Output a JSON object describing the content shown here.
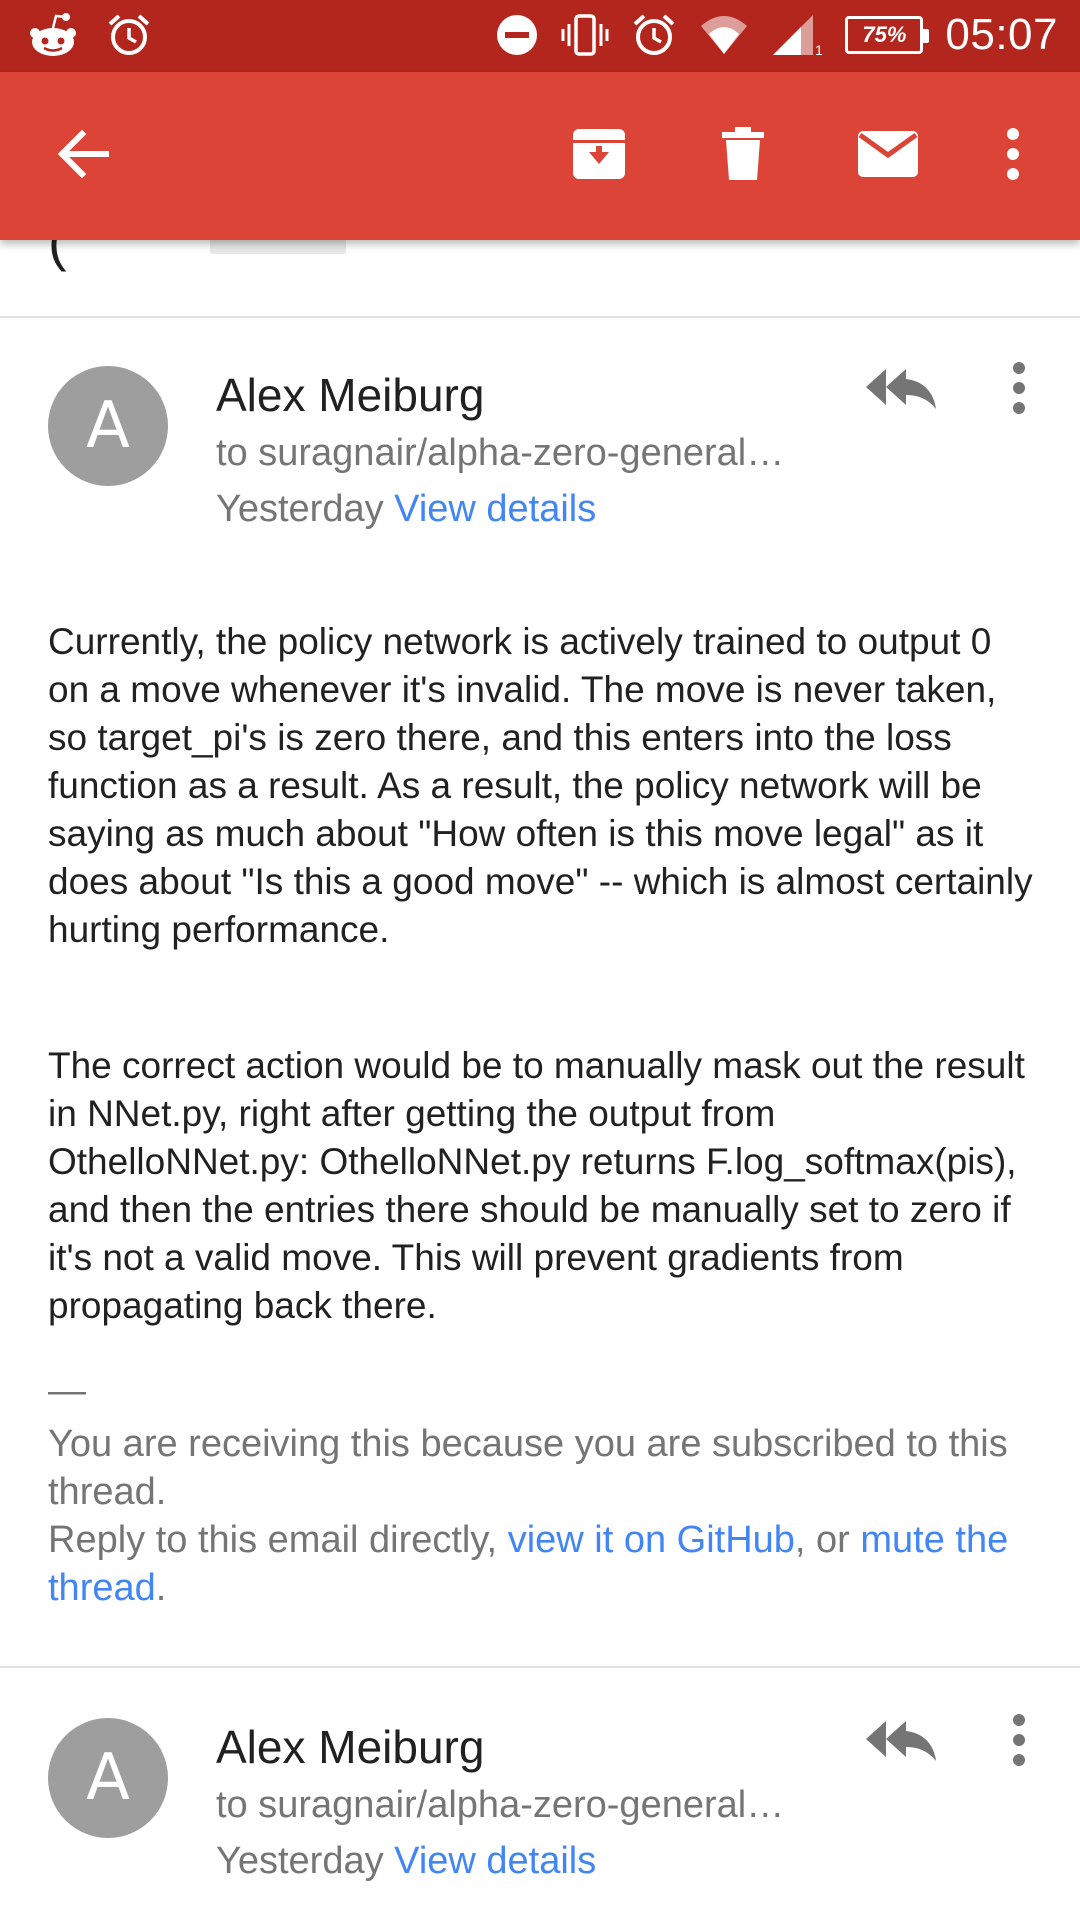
{
  "status_bar": {
    "battery_percent": "75%",
    "time": "05:07",
    "icons": [
      "reddit-icon",
      "alarm-icon",
      "do-not-disturb-icon",
      "vibrate-icon",
      "alarm-icon",
      "wifi-icon",
      "signal-icon",
      "battery-icon"
    ]
  },
  "toolbar": {
    "icons": [
      "back-arrow-icon",
      "archive-icon",
      "delete-icon",
      "mark-unread-icon",
      "more-vert-icon"
    ]
  },
  "messages": [
    {
      "avatar_letter": "A",
      "sender": "Alex Meiburg",
      "recipient": "to suragnair/alpha-zero-general…",
      "date": "Yesterday",
      "view_details": "View details",
      "body": [
        "Currently, the policy network is actively trained to output 0 on a move whenever it's invalid. The move is never taken, so target_pi's is zero there, and this enters into the loss function as a result. As a result, the policy network will be saying as much about \"How often is this move legal\" as it does about \"Is this a good move\" -- which is almost certainly hurting performance.",
        "The correct action would be to manually mask out the result in NNet.py, right after getting the output from OthelloNNet.py: OthelloNNet.py returns F.log_softmax(pis), and then the entries there should be manually set to zero if it's not a valid move. This will prevent gradients from propagating back there."
      ],
      "footer": {
        "dash": "—",
        "subscribed": "You are receiving this because you are subscribed to this thread.",
        "reply_prefix": "Reply to this email directly, ",
        "github_link": "view it on GitHub",
        "or": ", or ",
        "mute_link": "mute the thread",
        "period": "."
      }
    },
    {
      "avatar_letter": "A",
      "sender": "Alex Meiburg",
      "recipient": "to suragnair/alpha-zero-general…",
      "date": "Yesterday",
      "view_details": "View details"
    }
  ],
  "colors": {
    "status_bar": "#b3261e",
    "action_bar": "#db4437",
    "link": "#4285f4",
    "avatar": "#9e9e9e"
  }
}
